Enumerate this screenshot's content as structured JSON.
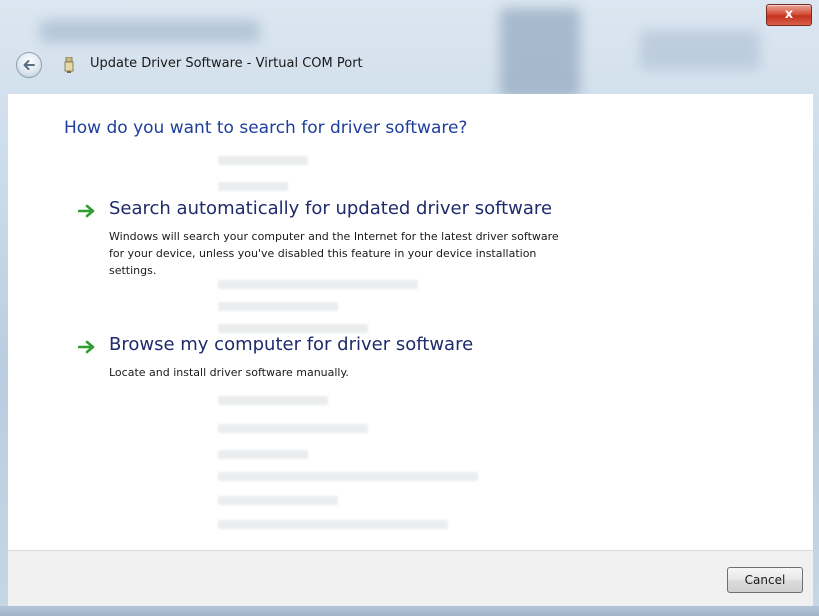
{
  "window": {
    "title": "Update Driver Software - Virtual COM Port",
    "close_symbol": "x",
    "icons": [
      "back-arrow-icon",
      "device-icon",
      "close-icon"
    ]
  },
  "main": {
    "heading": "How do you want to search for driver software?",
    "options": [
      {
        "title": "Search automatically for updated driver software",
        "description_lines": [
          "Windows will search your computer and the Internet for the latest driver software",
          "for your device, unless you've disabled this feature in your device installation",
          "settings."
        ],
        "icon": "green-arrow-icon"
      },
      {
        "title": "Browse my computer for driver software",
        "description_lines": [
          "Locate and install driver software manually."
        ],
        "icon": "green-arrow-icon"
      }
    ]
  },
  "footer": {
    "cancel_label": "Cancel"
  },
  "colors": {
    "heading": "#1e3e9c",
    "option_title": "#1f2a6b",
    "arrow": "#2e9e2e",
    "close_button": "#c4321d"
  }
}
